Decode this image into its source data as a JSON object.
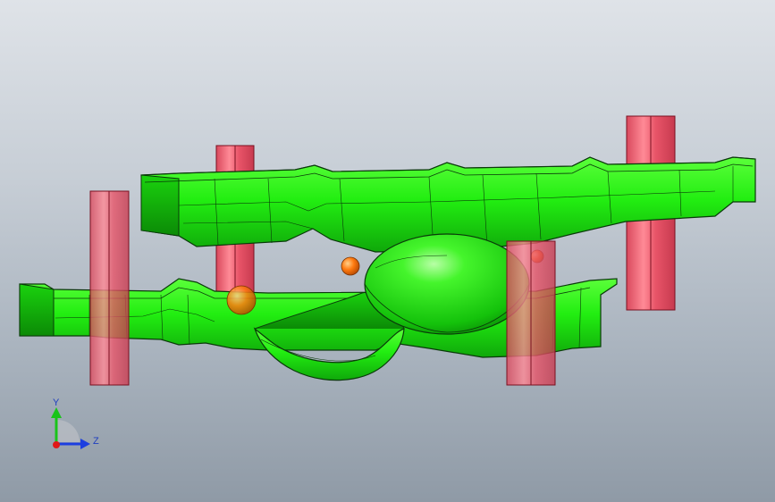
{
  "viewport": {
    "name": "3d-graphics-area",
    "background_top": "#dfe3e8",
    "background_bottom": "#8f9aa6"
  },
  "model": {
    "body_color": "#22ee11",
    "body_shadow": "#0fa80a",
    "edge_color": "#0a3a0a",
    "pin_color": "#e8556a",
    "pin_edge": "#7a1020",
    "ball_color": "#ff7a10"
  },
  "triad": {
    "y_label": "Y",
    "z_label": "Z",
    "y_color": "#19c41a",
    "z_color": "#1d3fe0",
    "x_color": "#e01818"
  }
}
